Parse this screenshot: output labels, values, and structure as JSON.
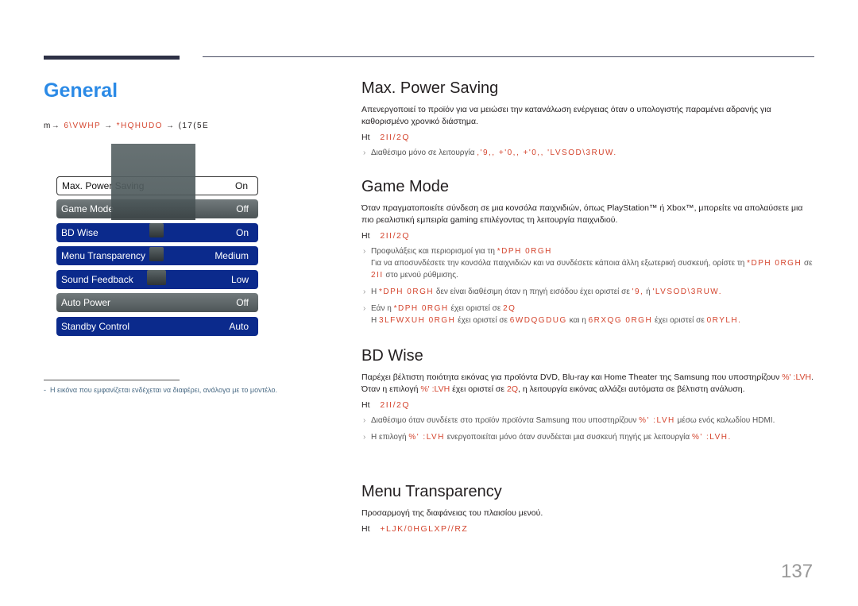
{
  "header": {
    "title": "General",
    "breadcrumb": {
      "prefix": "m→",
      "items": [
        "6\\VWHP",
        "*HQHUDO",
        "(17(5E"
      ],
      "separator": "→"
    }
  },
  "osd_menu": {
    "items": [
      {
        "label": "Max. Power Saving",
        "value": "On",
        "state": "selected"
      },
      {
        "label": "Game Mode",
        "value": "Off",
        "state": "grey"
      },
      {
        "label": "BD Wise",
        "value": "On",
        "state": "blue"
      },
      {
        "label": "Menu Transparency",
        "value": "Medium",
        "state": "blue"
      },
      {
        "label": "Sound Feedback",
        "value": "Low",
        "state": "blue"
      },
      {
        "label": "Auto Power",
        "value": "Off",
        "state": "grey"
      },
      {
        "label": "Standby Control",
        "value": "Auto",
        "state": "blue"
      }
    ]
  },
  "footnote": "Η εικόνα που εμφανίζεται ενδέχεται να διαφέρει, ανάλογα με το μοντέλο.",
  "sections": {
    "max_power_saving": {
      "title": "Max. Power Saving",
      "description": "Απενεργοποιεί το προϊόν για να μειώσει την κατανάλωση ενέργειας όταν ο υπολογιστής παραμένει αδρανής για καθορισμένο χρονικό διάστημα.",
      "options_prefix": "Ht",
      "options": "2II/2Q",
      "note_text": "Διαθέσιμο μόνο σε λειτουργία",
      "note_red": ",'9,, +'0,, +'0,, 'LVSOD\\3RUW."
    },
    "game_mode": {
      "title": "Game Mode",
      "description": "Όταν πραγματοποιείτε σύνδεση σε μια κονσόλα παιχνιδιών, όπως PlayStation™ ή Xbox™, μπορείτε να απολαύσετε μια πιο ρεαλιστική εμπειρία gaming επιλέγοντας τη λειτουργία παιχνιδιού.",
      "options_prefix": "Ht",
      "options": "2II/2Q",
      "notes": [
        {
          "text1": "Προφυλάξεις και περιορισμοί για τη",
          "red1": "*DPH 0RGH",
          "line2": "Για να αποσυνδέσετε την κονσόλα παιχνιδιών και να συνδέσετε κάποια άλλη εξωτερική συσκευή, ορίστε τη",
          "red2": "*DPH 0RGH",
          "text3": "σε",
          "red3": "2II",
          "text4": "στο μενού ρύθμισης."
        },
        {
          "text1": "Η",
          "red1": "*DPH 0RGH",
          "text2": "δεν είναι διαθέσιμη όταν η πηγή εισόδου έχει οριστεί σε",
          "red2": "'9,",
          "text3": "ή",
          "red3": "'LVSOD\\3RUW."
        },
        {
          "text1": "Εάν η",
          "red1": "*DPH 0RGH",
          "text2": "έχει οριστεί σε",
          "red2": "2Q",
          "line2_text1": "Η",
          "line2_red1": "3LFWXUH 0RGH",
          "line2_text2": "έχει οριστεί σε",
          "line2_red2": "6WDQGDUG",
          "line2_text3": "και η",
          "line2_red3": "6RXQG 0RGH",
          "line2_text4": "έχει οριστεί σε",
          "line2_red4": "0RYLH."
        }
      ]
    },
    "bd_wise": {
      "title": "BD Wise",
      "description_1": "Παρέχει βέλτιστη ποιότητα εικόνας για προϊόντα DVD, Blu-ray και Home Theater της Samsung που υποστηρίζουν",
      "red_1": "%' :LVH",
      "description_2": ". Όταν η επιλογή",
      "red_2": "%' :LVH",
      "description_3": "έχει οριστεί σε",
      "red_3": "2Q",
      "description_4": ", η λειτουργία εικόνας αλλάζει αυτόματα σε βέλτιστη ανάλυση.",
      "options_prefix": "Ht",
      "options": "2II/2Q",
      "notes": [
        {
          "text1": "Διαθέσιμο όταν συνδέετε στο προϊόν προϊόντα Samsung που υποστηρίζουν",
          "red1": "%' :LVH",
          "text2": "μέσω ενός καλωδίου HDMI."
        },
        {
          "text1": "Η επιλογή",
          "red1": "%' :LVH",
          "text2": "ενεργοποιείται μόνο όταν συνδέεται μια συσκευή πηγής με λειτουργία",
          "red2": "%' :LVH."
        }
      ]
    },
    "menu_transparency": {
      "title": "Menu Transparency",
      "description": "Προσαρμογή της διαφάνειας του πλαισίου μενού.",
      "options_prefix": "Ht",
      "options": "+LJK/0HGLXP//RZ"
    }
  },
  "page_number": "137",
  "colors": {
    "title_blue": "#2b8ae6",
    "accent_red": "#d4442d",
    "osd_blue": "#0b2a8c",
    "osd_grey": "#5a6466"
  }
}
